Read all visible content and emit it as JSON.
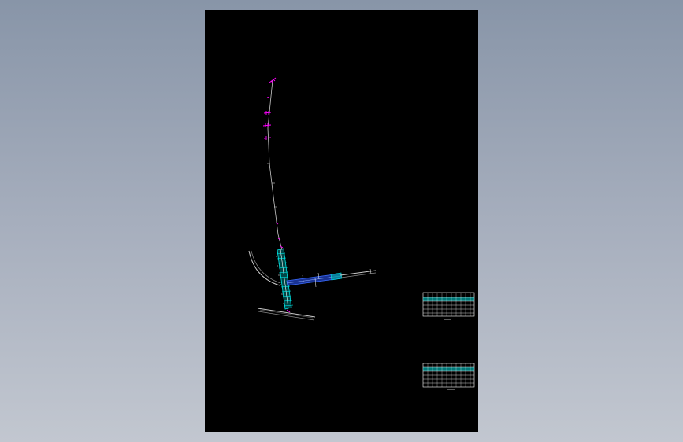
{
  "colors": {
    "viewport_top": "#8895a8",
    "viewport_bottom": "#c2c7d0",
    "sheet": "#000000",
    "road_line": "#c8c8c8",
    "annotation": "#ff00ff",
    "structure": "#00e5e5",
    "main_span": "#2b56d6",
    "label": "#ffffff"
  },
  "drawing": {
    "annotation_markers": 5,
    "tables": 2,
    "table_columns": 11,
    "table_rows": 5
  }
}
